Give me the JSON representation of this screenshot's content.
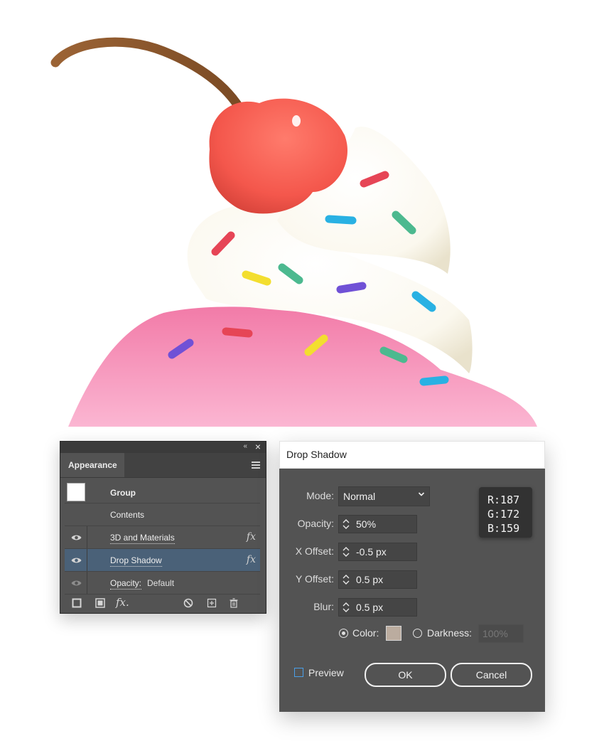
{
  "appearance_panel": {
    "tab": "Appearance",
    "rows": [
      {
        "label": "Group"
      },
      {
        "label": "Contents"
      },
      {
        "label": "3D and Materials",
        "fx": "fx"
      },
      {
        "label": "Drop Shadow",
        "fx": "fx",
        "selected": true
      },
      {
        "label": "Opacity:",
        "value": "Default"
      }
    ],
    "bottom_fx": "fx."
  },
  "drop_shadow_dialog": {
    "title": "Drop Shadow",
    "mode": {
      "label": "Mode:",
      "value": "Normal"
    },
    "opacity": {
      "label": "Opacity:",
      "value": "50%"
    },
    "x_offset": {
      "label": "X Offset:",
      "value": "-0.5 px"
    },
    "y_offset": {
      "label": "Y Offset:",
      "value": "0.5 px"
    },
    "blur": {
      "label": "Blur:",
      "value": "0.5 px"
    },
    "color_option": {
      "label": "Color:",
      "selected": true,
      "swatch": "#bbac9f"
    },
    "darkness_option": {
      "label": "Darkness:",
      "value": "100%",
      "selected": false
    },
    "rgb_readout": {
      "r": "R:187",
      "g": "G:172",
      "b": "B:159"
    },
    "preview": {
      "label": "Preview",
      "checked": false
    },
    "ok_label": "OK",
    "cancel_label": "Cancel"
  },
  "colors": {
    "panel_bg": "#535353",
    "selected_row": "#4a6178",
    "cherry": "#f4574c",
    "frosting_pink": "#f7a3c6",
    "cream": "#fffdf6"
  }
}
